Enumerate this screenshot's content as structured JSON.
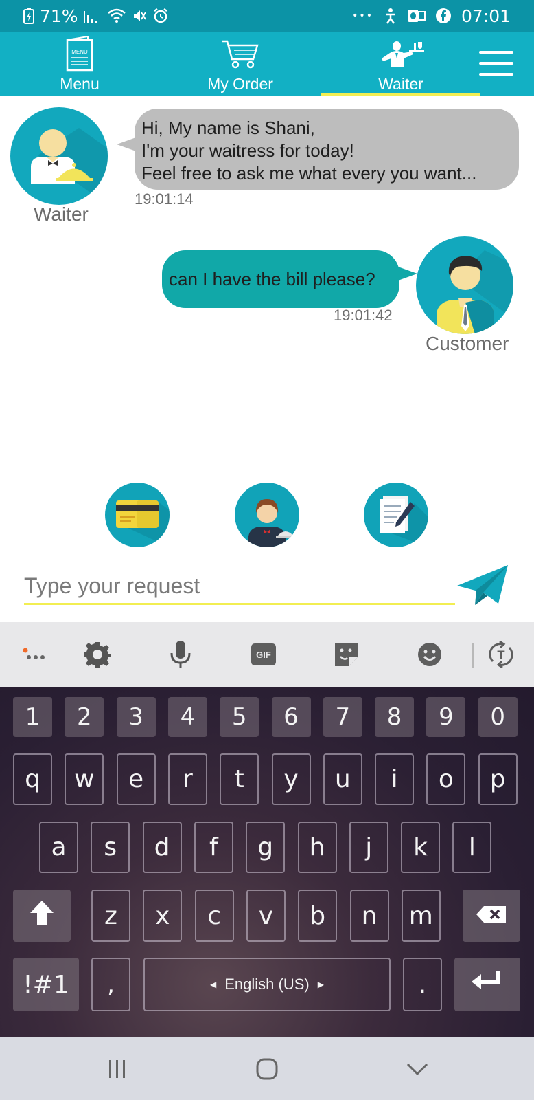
{
  "status_bar": {
    "battery": "71%",
    "time": "07:01",
    "dots": "•••"
  },
  "nav": {
    "tabs": [
      {
        "label": "Menu",
        "icon_text": "MENU"
      },
      {
        "label": "My Order"
      },
      {
        "label": "Waiter"
      }
    ],
    "active_tab": "Waiter",
    "accent_color": "#12b0c4",
    "underline_color": "#f2ee52"
  },
  "chat": {
    "messages": [
      {
        "sender": "Waiter",
        "lines": [
          "Hi, My name is Shani,",
          "I'm your waitress for today!",
          "Feel free to ask me what every you want..."
        ],
        "time": "19:01:14"
      },
      {
        "sender": "Customer",
        "text": "can I have the bill please?",
        "time": "19:01:42"
      }
    ]
  },
  "quick_actions": [
    "credit-card",
    "call-waiter",
    "write-note"
  ],
  "input": {
    "placeholder": "Type your request",
    "value": ""
  },
  "keyboard": {
    "numbers": [
      "1",
      "2",
      "3",
      "4",
      "5",
      "6",
      "7",
      "8",
      "9",
      "0"
    ],
    "row1": [
      "q",
      "w",
      "e",
      "r",
      "t",
      "y",
      "u",
      "i",
      "o",
      "p"
    ],
    "row2": [
      "a",
      "s",
      "d",
      "f",
      "g",
      "h",
      "j",
      "k",
      "l"
    ],
    "row3": [
      "z",
      "x",
      "c",
      "v",
      "b",
      "n",
      "m"
    ],
    "symbols_label": "!#1",
    "comma": ",",
    "period": ".",
    "language": "English (US)",
    "gif_label": "GIF"
  }
}
